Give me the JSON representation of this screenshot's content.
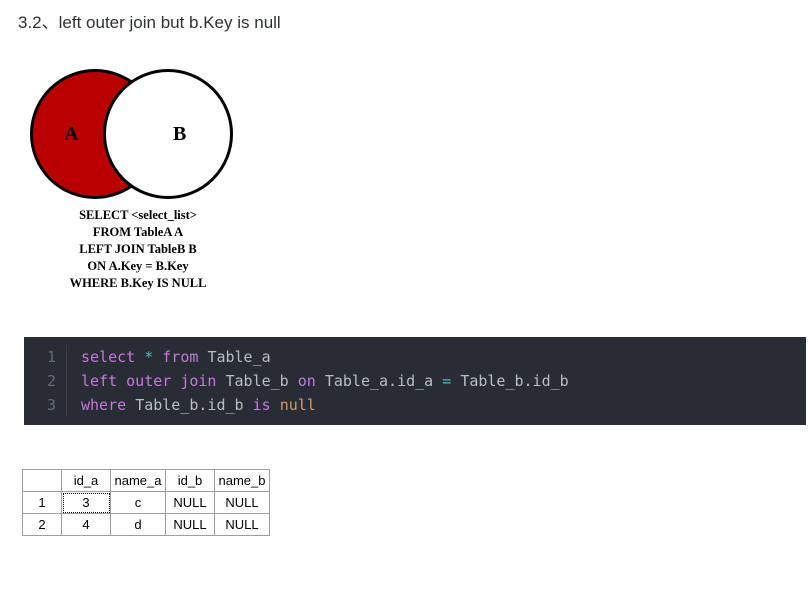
{
  "heading": "3.2、left outer join but b.Key is null",
  "venn": {
    "labelA": "A",
    "labelB": "B"
  },
  "sql_spec": {
    "l1": "SELECT <select_list>",
    "l2": "FROM TableA A",
    "l3": "LEFT JOIN TableB B",
    "l4": "ON A.Key = B.Key",
    "l5": "WHERE B.Key IS NULL"
  },
  "code": {
    "line1": {
      "n": "1",
      "kw1": "select",
      "star": "*",
      "kw2": "from",
      "t": "Table_a"
    },
    "line2": {
      "n": "2",
      "kw1": "left",
      "kw2": "outer",
      "kw3": "join",
      "t1": "Table_b",
      "kw4": "on",
      "e1": "Table_a.id_a",
      "op": "=",
      "e2": "Table_b.id_b"
    },
    "line3": {
      "n": "3",
      "kw1": "where",
      "e1": "Table_b.id_b",
      "kw2": "is",
      "nv": "null"
    }
  },
  "result": {
    "headers": {
      "c0": "",
      "c1": "id_a",
      "c2": "name_a",
      "c3": "id_b",
      "c4": "name_b"
    },
    "rows": [
      {
        "i": "1",
        "id_a": "3",
        "name_a": "c",
        "id_b": "NULL",
        "name_b": "NULL"
      },
      {
        "i": "2",
        "id_a": "4",
        "name_a": "d",
        "id_b": "NULL",
        "name_b": "NULL"
      }
    ]
  }
}
